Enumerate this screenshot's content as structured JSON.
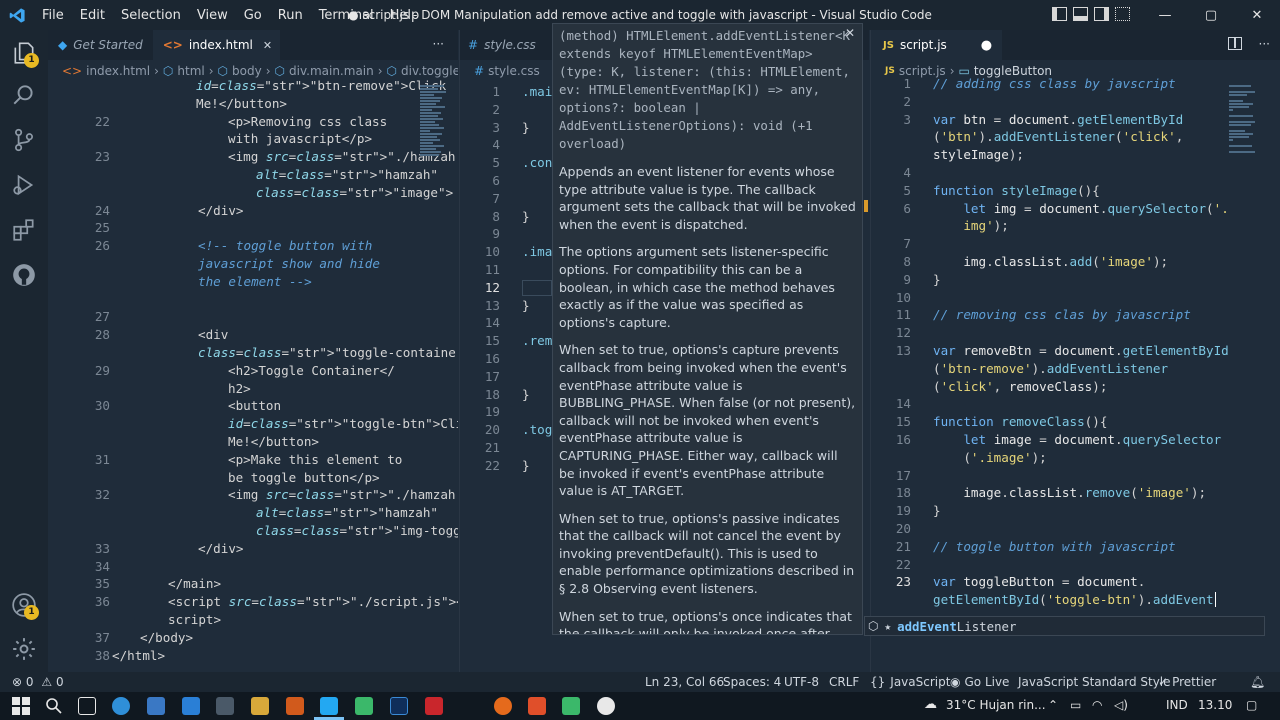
{
  "window": {
    "title": "● script.js - DOM Manipulation add remove active and toggle with javascript - Visual Studio Code",
    "menu": [
      "File",
      "Edit",
      "Selection",
      "View",
      "Go",
      "Run",
      "Terminal",
      "Help"
    ],
    "minimize": "—",
    "maximize": "▢",
    "close": "✕"
  },
  "activity": {
    "explorer_badge": "1",
    "accounts_badge": "1"
  },
  "left_pane": {
    "tabs": [
      {
        "label": "Get Started",
        "active": false
      },
      {
        "label": "index.html",
        "active": true,
        "close": "✕"
      }
    ],
    "more": "···",
    "breadcrumb": [
      "index.html",
      "html",
      "body",
      "div.main.main",
      "div.toggle-cont"
    ],
    "lines": [
      {
        "n": "",
        "text": "id=\"btn-remove\">Click"
      },
      {
        "n": "",
        "text": "Me!</button>"
      },
      {
        "n": "22",
        "text": "<p>Removing css class"
      },
      {
        "n": "",
        "text": "with javascript</p>"
      },
      {
        "n": "23",
        "text": "<img src=\"./hamzah.png\""
      },
      {
        "n": "",
        "text": "alt=\"hamzah\""
      },
      {
        "n": "",
        "text": "class=\"image\">"
      },
      {
        "n": "24",
        "text": "</div>"
      },
      {
        "n": "25",
        "text": ""
      },
      {
        "n": "26",
        "text": "<!-- toggle button with"
      },
      {
        "n": "",
        "text": "javascript show and hide"
      },
      {
        "n": "",
        "text": "the element -->"
      },
      {
        "n": "",
        "text": ""
      },
      {
        "n": "27",
        "text": ""
      },
      {
        "n": "28",
        "text": "<div"
      },
      {
        "n": "",
        "text": "class=\"toggle-container\">"
      },
      {
        "n": "29",
        "text": "<h2>Toggle Container</"
      },
      {
        "n": "",
        "text": "h2>"
      },
      {
        "n": "30",
        "text": "<button"
      },
      {
        "n": "",
        "text": "id=\"toggle-btn\">Click"
      },
      {
        "n": "",
        "text": "Me!</button>"
      },
      {
        "n": "31",
        "text": "<p>Make this element to"
      },
      {
        "n": "",
        "text": "be toggle button</p>"
      },
      {
        "n": "32",
        "text": "<img src=\"./hamzah.png\""
      },
      {
        "n": "",
        "text": "alt=\"hamzah\""
      },
      {
        "n": "",
        "text": "class=\"img-toggle\">"
      },
      {
        "n": "33",
        "text": "</div>"
      },
      {
        "n": "34",
        "text": ""
      },
      {
        "n": "35",
        "text": "</main>"
      },
      {
        "n": "36",
        "text": "<script src=\"./script.js\"></"
      },
      {
        "n": "",
        "text": "script>"
      },
      {
        "n": "37",
        "text": "</body>"
      },
      {
        "n": "38",
        "text": "</html>"
      }
    ]
  },
  "middle_pane": {
    "tab": "style.css",
    "breadcrumb": "style.css",
    "line_numbers": [
      "1",
      "2",
      "3",
      "4",
      "5",
      "6",
      "7",
      "8",
      "9",
      "10",
      "11",
      "12",
      "13",
      "14",
      "15",
      "16",
      "17",
      "18",
      "19",
      "20",
      "21",
      "22"
    ],
    "fragments": [
      ".mai",
      "",
      "}",
      "",
      ".con",
      "",
      "",
      "}",
      "",
      ".imag",
      "",
      "",
      "}",
      "",
      ".remo",
      "",
      "",
      "}",
      "",
      ".togg",
      "",
      "}"
    ]
  },
  "hover": {
    "close": "✕",
    "signature": "(method) HTMLElement.addEventListener<K extends keyof HTMLElementEventMap>(type: K, listener: (this: HTMLElement, ev: HTMLElementEventMap[K]) => any, options?: boolean | AddEventListenerOptions): void (+1 overload)",
    "paragraphs": [
      "Appends an event listener for events whose type attribute value is type. The callback argument sets the callback that will be invoked when the event is dispatched.",
      "The options argument sets listener-specific options. For compatibility this can be a boolean, in which case the method behaves exactly as if the value was specified as options's capture.",
      "When set to true, options's capture prevents callback from being invoked when the event's eventPhase attribute value is BUBBLING_PHASE. When false (or not present), callback will not be invoked when event's eventPhase attribute value is CAPTURING_PHASE. Either way, callback will be invoked if event's eventPhase attribute value is AT_TARGET.",
      "When set to true, options's passive indicates that the callback will not cancel the event by invoking preventDefault(). This is used to enable performance optimizations described in § 2.8 Observing event listeners.",
      "When set to true, options's once indicates that the callback will only be invoked once after which the event listener will be removed."
    ]
  },
  "right_pane": {
    "tab": "script.js",
    "tab_icon": "JS",
    "dirty": "●",
    "breadcrumb": [
      "script.js",
      "toggleButton"
    ],
    "line_numbers": [
      "1",
      "2",
      "3",
      "",
      "",
      "4",
      "5",
      "6",
      "",
      "7",
      "8",
      "9",
      "10",
      "11",
      "12",
      "13",
      "",
      "",
      "14",
      "15",
      "16",
      "",
      "17",
      "18",
      "19",
      "20",
      "21",
      "22",
      "23",
      ""
    ]
  },
  "suggest": {
    "match": "addEvent",
    "rest": "Listener"
  },
  "status": {
    "errors": "0",
    "warnings": "0",
    "position": "Ln 23, Col 66",
    "spaces": "Spaces: 4",
    "encoding": "UTF-8",
    "eol": "CRLF",
    "language": "JavaScript",
    "golive": "Go Live",
    "style": "JavaScript Standard Style",
    "prettier": "Prettier"
  },
  "taskbar": {
    "weather": "31°C  Hujan rin...",
    "lang": "IND",
    "time": "13.10"
  }
}
